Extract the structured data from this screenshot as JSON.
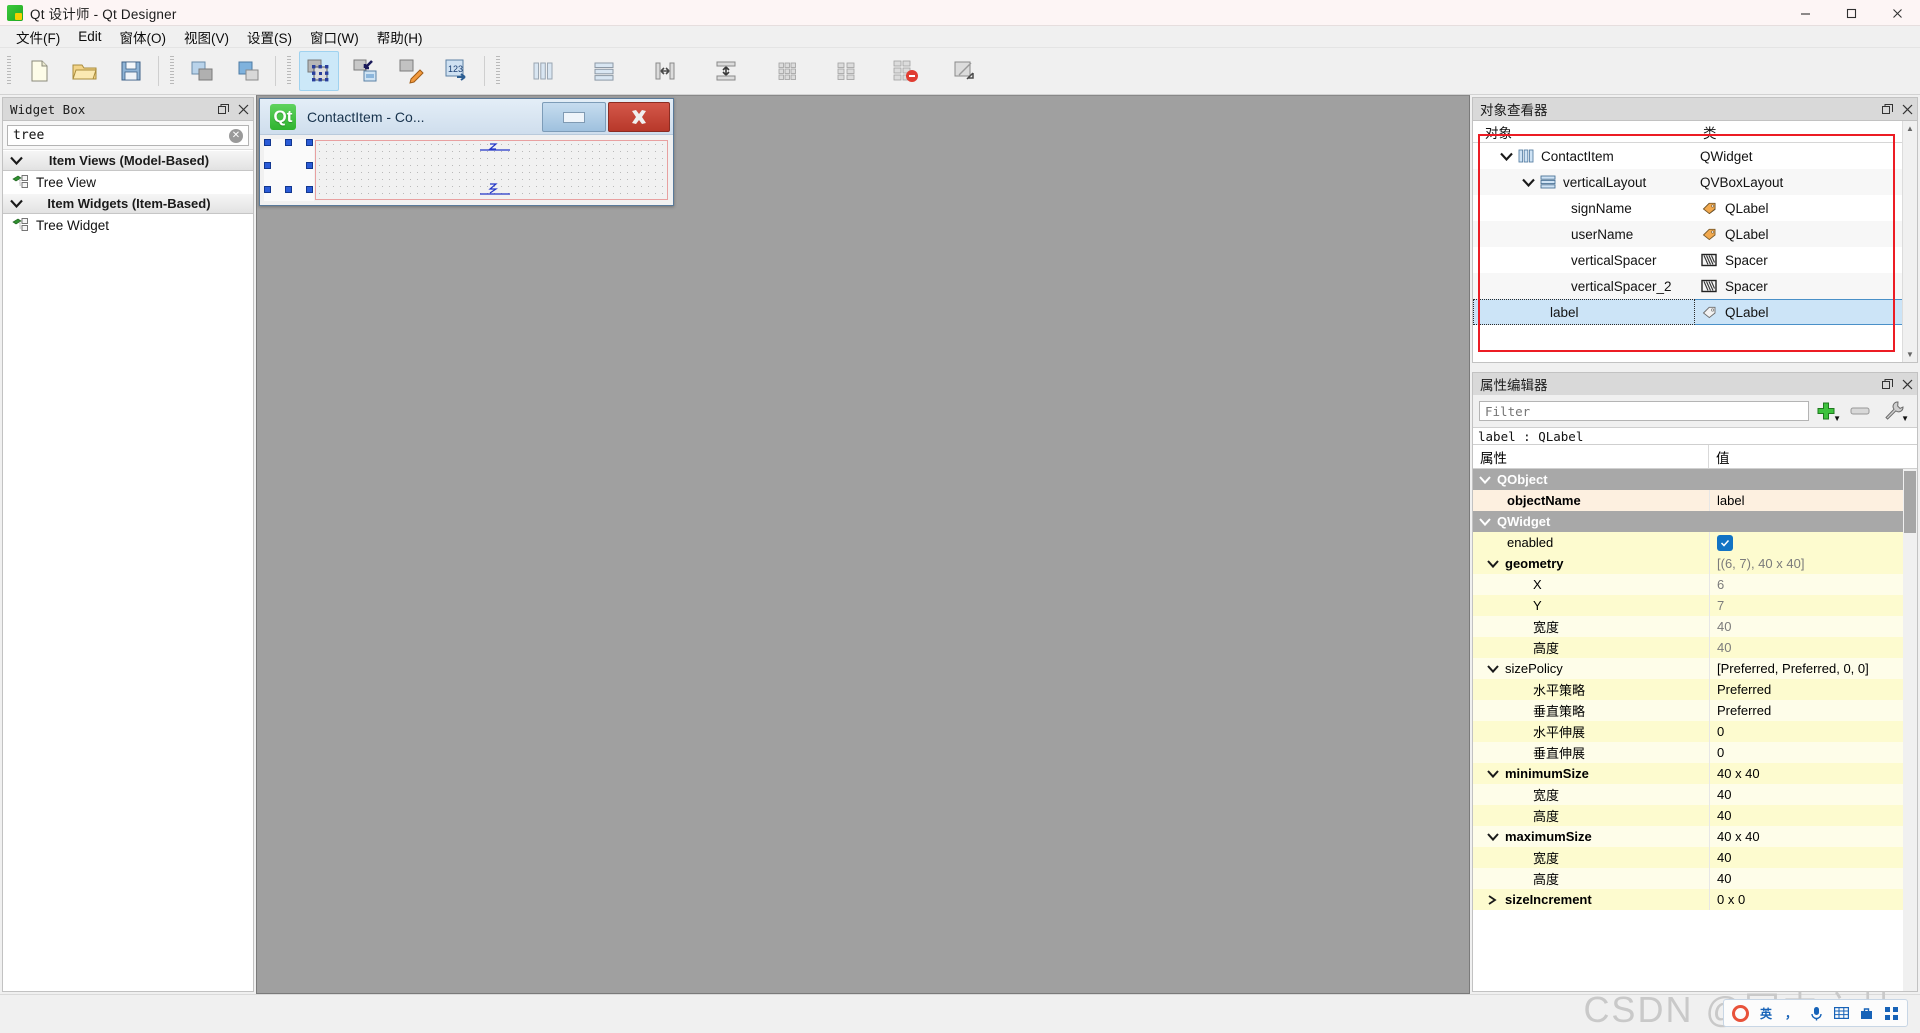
{
  "window": {
    "title": "Qt 设计师 - Qt Designer",
    "icon": "qt-designer-icon",
    "minimize_label": "─",
    "maximize_label": "❐",
    "close_label": "✕"
  },
  "menubar": {
    "items": [
      {
        "label": "文件(F)",
        "mnemonic": "F"
      },
      {
        "label": "Edit",
        "mnemonic": "E"
      },
      {
        "label": "窗体(O)",
        "mnemonic": "O"
      },
      {
        "label": "视图(V)",
        "mnemonic": "V"
      },
      {
        "label": "设置(S)",
        "mnemonic": "S"
      },
      {
        "label": "窗口(W)",
        "mnemonic": "W"
      },
      {
        "label": "帮助(H)",
        "mnemonic": "H"
      }
    ]
  },
  "toolbar": {
    "groups": [
      {
        "buttons": [
          {
            "name": "new-form-icon",
            "tooltip": "新建"
          },
          {
            "name": "open-folder-icon",
            "tooltip": "打开"
          },
          {
            "name": "save-icon",
            "tooltip": "保存"
          }
        ]
      },
      {
        "buttons": [
          {
            "name": "undo-icon",
            "tooltip": "撤销"
          },
          {
            "name": "redo-icon",
            "tooltip": "重做"
          }
        ]
      },
      {
        "buttons": [
          {
            "name": "edit-widgets-icon",
            "tooltip": "编辑控件",
            "active": true
          },
          {
            "name": "edit-signals-slots-icon",
            "tooltip": "编辑信号/槽"
          },
          {
            "name": "edit-buddies-icon",
            "tooltip": "编辑伙伴"
          },
          {
            "name": "edit-tab-order-icon",
            "tooltip": "编辑 Tab 顺序"
          }
        ]
      },
      {
        "buttons": [
          {
            "name": "layout-horizontal-icon",
            "tooltip": "水平布局"
          },
          {
            "name": "layout-vertical-icon",
            "tooltip": "垂直布局"
          },
          {
            "name": "layout-splitter-horizontal-icon",
            "tooltip": "水平拆分器布局"
          },
          {
            "name": "layout-splitter-vertical-icon",
            "tooltip": "垂直拆分器布局"
          },
          {
            "name": "layout-grid-icon",
            "tooltip": "栅格布局"
          },
          {
            "name": "layout-form-icon",
            "tooltip": "表单布局"
          },
          {
            "name": "break-layout-icon",
            "tooltip": "打破布局"
          },
          {
            "name": "adjust-size-icon",
            "tooltip": "调整大小"
          }
        ]
      }
    ]
  },
  "widget_box": {
    "title": "Widget Box",
    "float_icon": "restore-icon",
    "close_icon": "close-icon",
    "search": {
      "value": "tree",
      "placeholder": "Filter",
      "clear_icon": "clear-icon"
    },
    "categories": [
      {
        "label": "Item Views (Model-Based)",
        "expanded": true,
        "items": [
          {
            "label": "Tree View",
            "icon": "tree-view-icon"
          }
        ]
      },
      {
        "label": "Item Widgets (Item-Based)",
        "expanded": true,
        "items": [
          {
            "label": "Tree Widget",
            "icon": "tree-widget-icon"
          }
        ]
      }
    ]
  },
  "form_window": {
    "title": "ContactItem - Co...",
    "qt_logo_text": "Qt",
    "minimize_label": "",
    "close_label": "✕",
    "spacer_glyphs": [
      "≈",
      "≈"
    ]
  },
  "object_inspector": {
    "title": "对象查看器",
    "float_icon": "restore-icon",
    "close_icon": "close-icon",
    "columns": [
      "对象",
      "类"
    ],
    "rows": [
      {
        "name": "ContactItem",
        "class": "QWidget",
        "indent": 0,
        "expanded": true,
        "icon": "qwidget-icon",
        "selected": false
      },
      {
        "name": "verticalLayout",
        "class": "QVBoxLayout",
        "indent": 1,
        "expanded": true,
        "icon": "vboxlayout-icon",
        "selected": false
      },
      {
        "name": "signName",
        "class": "QLabel",
        "indent": 2,
        "expanded": null,
        "icon": "qlabel-icon",
        "selected": false
      },
      {
        "name": "userName",
        "class": "QLabel",
        "indent": 2,
        "expanded": null,
        "icon": "qlabel-icon",
        "selected": false
      },
      {
        "name": "verticalSpacer",
        "class": "Spacer",
        "indent": 2,
        "expanded": null,
        "icon": "spacer-icon",
        "selected": false
      },
      {
        "name": "verticalSpacer_2",
        "class": "Spacer",
        "indent": 2,
        "expanded": null,
        "icon": "spacer-icon",
        "selected": false
      },
      {
        "name": "label",
        "class": "QLabel",
        "indent": 2,
        "expanded": null,
        "icon": "qlabel-icon",
        "selected": true
      }
    ],
    "highlight_color": "#ec1c24",
    "selection_color": "#cce4f7"
  },
  "property_editor": {
    "title": "属性编辑器",
    "float_icon": "restore-icon",
    "close_icon": "close-icon",
    "filter": {
      "value": "",
      "placeholder": "Filter"
    },
    "tools": [
      {
        "name": "add-dynamic-property-button",
        "icon": "plus-icon"
      },
      {
        "name": "remove-dynamic-property-button",
        "icon": "minus-icon"
      },
      {
        "name": "configure-button",
        "icon": "wrench-icon"
      }
    ],
    "object_line": "label : QLabel",
    "columns": [
      "属性",
      "值"
    ],
    "rows": [
      {
        "kind": "group",
        "name": "QObject",
        "value": "",
        "indent": 0,
        "expanded": true
      },
      {
        "kind": "prop",
        "name": "objectName",
        "value": "label",
        "indent": 1,
        "bold": true,
        "bg": "peach"
      },
      {
        "kind": "group",
        "name": "QWidget",
        "value": "",
        "indent": 0,
        "expanded": true
      },
      {
        "kind": "prop",
        "name": "enabled",
        "value": "",
        "checkbox": true,
        "indent": 1,
        "bold": false,
        "bg": "yellow"
      },
      {
        "kind": "prop",
        "name": "geometry",
        "value": "[(6, 7), 40 x 40]",
        "indent": 0,
        "bold": true,
        "bg": "yellow",
        "expanded": true,
        "grey": true
      },
      {
        "kind": "prop",
        "name": "X",
        "value": "6",
        "indent": 2,
        "bold": false,
        "bg": "yellow2",
        "grey": true
      },
      {
        "kind": "prop",
        "name": "Y",
        "value": "7",
        "indent": 2,
        "bold": false,
        "bg": "yellow",
        "grey": true
      },
      {
        "kind": "prop",
        "name": "宽度",
        "value": "40",
        "indent": 2,
        "bold": false,
        "bg": "yellow2",
        "grey": true
      },
      {
        "kind": "prop",
        "name": "高度",
        "value": "40",
        "indent": 2,
        "bold": false,
        "bg": "yellow",
        "grey": true
      },
      {
        "kind": "prop",
        "name": "sizePolicy",
        "value": "[Preferred, Preferred, 0, 0]",
        "indent": 0,
        "bold": false,
        "bg": "yellow2",
        "expanded": true
      },
      {
        "kind": "prop",
        "name": "水平策略",
        "value": "Preferred",
        "indent": 2,
        "bold": false,
        "bg": "yellow"
      },
      {
        "kind": "prop",
        "name": "垂直策略",
        "value": "Preferred",
        "indent": 2,
        "bold": false,
        "bg": "yellow2"
      },
      {
        "kind": "prop",
        "name": "水平伸展",
        "value": "0",
        "indent": 2,
        "bold": false,
        "bg": "yellow"
      },
      {
        "kind": "prop",
        "name": "垂直伸展",
        "value": "0",
        "indent": 2,
        "bold": false,
        "bg": "yellow2"
      },
      {
        "kind": "prop",
        "name": "minimumSize",
        "value": "40 x 40",
        "indent": 0,
        "bold": true,
        "bg": "yellow",
        "expanded": true
      },
      {
        "kind": "prop",
        "name": "宽度",
        "value": "40",
        "indent": 2,
        "bold": false,
        "bg": "yellow2"
      },
      {
        "kind": "prop",
        "name": "高度",
        "value": "40",
        "indent": 2,
        "bold": false,
        "bg": "yellow"
      },
      {
        "kind": "prop",
        "name": "maximumSize",
        "value": "40 x 40",
        "indent": 0,
        "bold": true,
        "bg": "yellow2",
        "expanded": true
      },
      {
        "kind": "prop",
        "name": "宽度",
        "value": "40",
        "indent": 2,
        "bold": false,
        "bg": "yellow"
      },
      {
        "kind": "prop",
        "name": "高度",
        "value": "40",
        "indent": 2,
        "bold": false,
        "bg": "yellow2"
      },
      {
        "kind": "prop",
        "name": "sizeIncrement",
        "value": "0 x 0",
        "indent": 0,
        "bold": true,
        "bg": "yellow",
        "expanded": false
      }
    ]
  },
  "status_area": {
    "watermark": "CSDN @国中之林",
    "ime": {
      "logo": "sogou-ime-icon",
      "buttons": [
        {
          "name": "ime-mode-chinese",
          "label": "英"
        },
        {
          "name": "ime-punctuation",
          "label": "，"
        },
        {
          "name": "ime-voice-input",
          "label": "voice-icon"
        },
        {
          "name": "ime-keyboard",
          "label": "keyboard-icon"
        },
        {
          "name": "ime-toolbox",
          "label": "toolbox-icon"
        },
        {
          "name": "ime-menu",
          "label": "menu-icon"
        }
      ]
    }
  }
}
